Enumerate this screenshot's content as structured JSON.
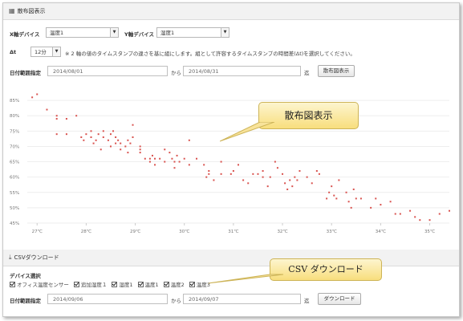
{
  "section1": {
    "title": "散布図表示",
    "icon": "chart-icon"
  },
  "x_device": {
    "label": "X軸デバイス",
    "value": "温度1"
  },
  "y_device": {
    "label": "Y軸デバイス",
    "value": "湿度1"
  },
  "delta": {
    "label": "Δt",
    "value": "12分",
    "description": "※ 2 軸の値のタイムスタンプの違さを基に組にします。組として許容するタイムスタンプの時間差(Δt)を選択してください。"
  },
  "date_range1": {
    "label": "日付範囲指定",
    "from": "2014/08/01",
    "separator": "から",
    "to": "2014/08/31",
    "suffix": "迄",
    "button": "散布図表示"
  },
  "callout1": "散布図表示",
  "callout2": "CSV ダウンロード",
  "section2": {
    "title": "CSVダウンロード",
    "icon": "download-icon"
  },
  "device_select": {
    "label": "デバイス選択",
    "options": [
      "オフィス温度センサー",
      "追加湿度１",
      "湿度1",
      "温度1",
      "温度2",
      "温度3"
    ]
  },
  "date_range2": {
    "label": "日付範囲指定",
    "from": "2014/09/06",
    "separator": "から",
    "to": "2014/09/07",
    "suffix": "迄",
    "button": "ダウンロード"
  },
  "chart_data": {
    "type": "scatter",
    "title": "",
    "xlabel": "",
    "ylabel": "",
    "xlim": [
      26.8,
      35.4
    ],
    "ylim": [
      45,
      90
    ],
    "x_ticks": [
      "27℃",
      "28℃",
      "29℃",
      "30℃",
      "31℃",
      "32℃",
      "33℃",
      "34℃",
      "35℃"
    ],
    "y_ticks": [
      "45%",
      "50%",
      "55%",
      "60%",
      "65%",
      "70%",
      "75%",
      "80%",
      "85%"
    ],
    "point_color": "#d9534f",
    "grid": true,
    "points": [
      [
        26.9,
        86
      ],
      [
        27.0,
        87
      ],
      [
        27.2,
        82
      ],
      [
        27.4,
        80
      ],
      [
        27.4,
        79
      ],
      [
        27.4,
        74
      ],
      [
        27.6,
        74
      ],
      [
        27.6,
        79
      ],
      [
        27.8,
        80
      ],
      [
        27.9,
        73
      ],
      [
        27.95,
        72
      ],
      [
        28.0,
        74
      ],
      [
        28.1,
        73
      ],
      [
        28.1,
        75
      ],
      [
        28.15,
        71
      ],
      [
        28.2,
        72
      ],
      [
        28.25,
        74
      ],
      [
        28.3,
        69
      ],
      [
        28.35,
        73
      ],
      [
        28.35,
        75
      ],
      [
        28.45,
        72
      ],
      [
        28.5,
        70
      ],
      [
        28.5,
        74
      ],
      [
        28.55,
        75
      ],
      [
        28.6,
        71
      ],
      [
        28.6,
        73
      ],
      [
        28.65,
        72
      ],
      [
        28.7,
        69
      ],
      [
        28.7,
        71
      ],
      [
        28.8,
        70
      ],
      [
        28.85,
        68
      ],
      [
        28.85,
        72
      ],
      [
        28.9,
        71
      ],
      [
        28.95,
        73
      ],
      [
        28.95,
        77
      ],
      [
        29.1,
        68
      ],
      [
        29.1,
        70
      ],
      [
        29.1,
        69
      ],
      [
        29.2,
        66
      ],
      [
        29.3,
        66
      ],
      [
        29.3,
        65
      ],
      [
        29.35,
        67
      ],
      [
        29.4,
        66
      ],
      [
        29.4,
        64
      ],
      [
        29.5,
        66
      ],
      [
        29.6,
        65
      ],
      [
        29.6,
        69
      ],
      [
        29.7,
        68
      ],
      [
        29.75,
        66
      ],
      [
        29.8,
        65
      ],
      [
        29.8,
        63
      ],
      [
        29.85,
        67
      ],
      [
        29.9,
        65
      ],
      [
        30.0,
        66
      ],
      [
        30.1,
        64
      ],
      [
        30.1,
        72
      ],
      [
        30.25,
        66
      ],
      [
        30.4,
        64
      ],
      [
        30.45,
        60
      ],
      [
        30.5,
        62
      ],
      [
        30.5,
        61
      ],
      [
        30.6,
        59
      ],
      [
        30.75,
        61
      ],
      [
        30.75,
        65
      ],
      [
        30.95,
        61
      ],
      [
        31.0,
        62
      ],
      [
        31.1,
        64
      ],
      [
        31.2,
        59
      ],
      [
        31.3,
        58
      ],
      [
        31.4,
        61
      ],
      [
        31.5,
        61
      ],
      [
        31.6,
        62
      ],
      [
        31.6,
        60
      ],
      [
        31.7,
        57
      ],
      [
        31.75,
        60
      ],
      [
        31.85,
        65
      ],
      [
        31.9,
        63
      ],
      [
        32.0,
        61
      ],
      [
        32.05,
        58
      ],
      [
        32.1,
        56
      ],
      [
        32.15,
        59
      ],
      [
        32.2,
        57
      ],
      [
        32.25,
        60
      ],
      [
        32.3,
        59
      ],
      [
        32.35,
        62
      ],
      [
        32.5,
        60
      ],
      [
        32.6,
        58
      ],
      [
        32.7,
        62
      ],
      [
        32.75,
        61
      ],
      [
        32.9,
        53
      ],
      [
        32.95,
        55
      ],
      [
        33.0,
        57
      ],
      [
        33.05,
        54
      ],
      [
        33.1,
        53
      ],
      [
        33.15,
        59
      ],
      [
        33.3,
        55
      ],
      [
        33.35,
        52
      ],
      [
        33.4,
        50
      ],
      [
        33.45,
        56
      ],
      [
        33.5,
        53
      ],
      [
        33.6,
        53
      ],
      [
        33.8,
        50
      ],
      [
        33.9,
        53
      ],
      [
        34.0,
        51
      ],
      [
        34.2,
        52
      ],
      [
        34.3,
        48
      ],
      [
        34.4,
        48
      ],
      [
        34.6,
        49
      ],
      [
        34.7,
        47
      ],
      [
        34.8,
        46
      ],
      [
        35.0,
        46
      ],
      [
        35.2,
        48
      ],
      [
        35.4,
        49
      ]
    ]
  }
}
